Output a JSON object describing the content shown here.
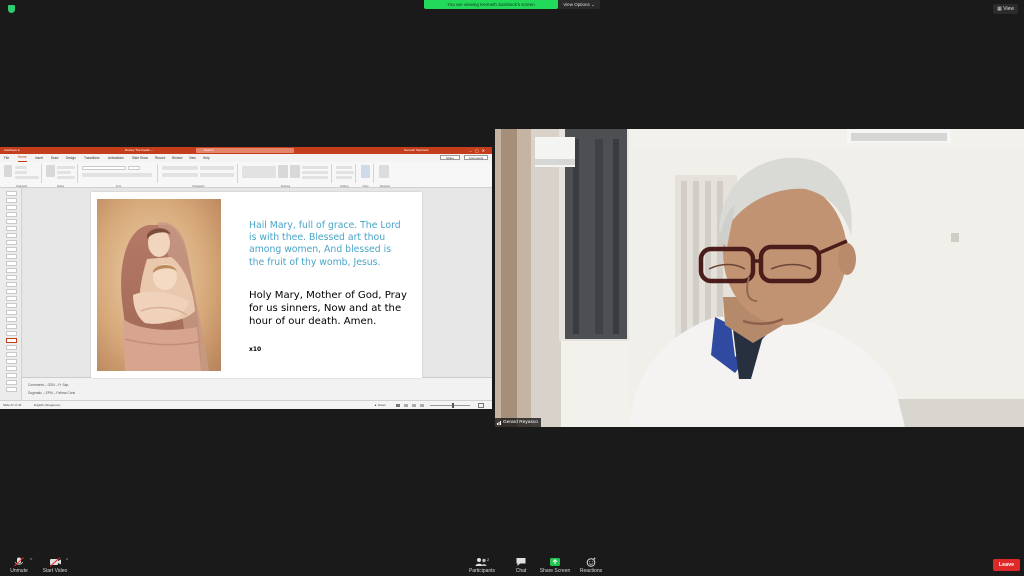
{
  "top_bar": {
    "share_banner": "You are viewing Kenneth Sambeck's screen",
    "view_options": "View Options ⌄",
    "view_button": "View"
  },
  "powerpoint": {
    "autosave": "AutoSave  ●",
    "file_name": "Rosary The Dyads  ⌄",
    "search_placeholder": "Search",
    "user": "Kenneth Sambeck",
    "tabs": [
      "File",
      "Home",
      "Insert",
      "Draw",
      "Design",
      "Transitions",
      "Animations",
      "Slide Show",
      "Record",
      "Review",
      "View",
      "Help"
    ],
    "active_tab": "Home",
    "share_label": "Share",
    "comments_label": "Comments",
    "ribbon_groups": [
      "Clipboard",
      "Slides",
      "Font",
      "Paragraph",
      "Drawing",
      "Editing",
      "Voice",
      "Designer"
    ],
    "notes_lines": [
      "Comments – GSN – Fr Sap",
      "Dogmatic – EPM – Fatima Chris"
    ],
    "status_slide": "Slide 27 of 42",
    "status_lang": "English (Singapore)",
    "status_right": "▲ Notes",
    "slide": {
      "blue_text": "Hail Mary, full of grace. The Lord is with thee. Blessed art thou among women, And blessed is the fruit of thy womb, Jesus.",
      "black_text": "Holy Mary, Mother of God, Pray for us sinners, Now and at the hour of our death. Amen.",
      "repeat": "x10"
    }
  },
  "video": {
    "participant_name": "Gerard Reyasco"
  },
  "toolbar": {
    "unmute": "Unmute",
    "start_video": "Start Video",
    "participants": "Participants",
    "participants_count": "2",
    "chat": "Chat",
    "share_screen": "Share Screen",
    "reactions": "Reactions",
    "leave": "Leave"
  }
}
